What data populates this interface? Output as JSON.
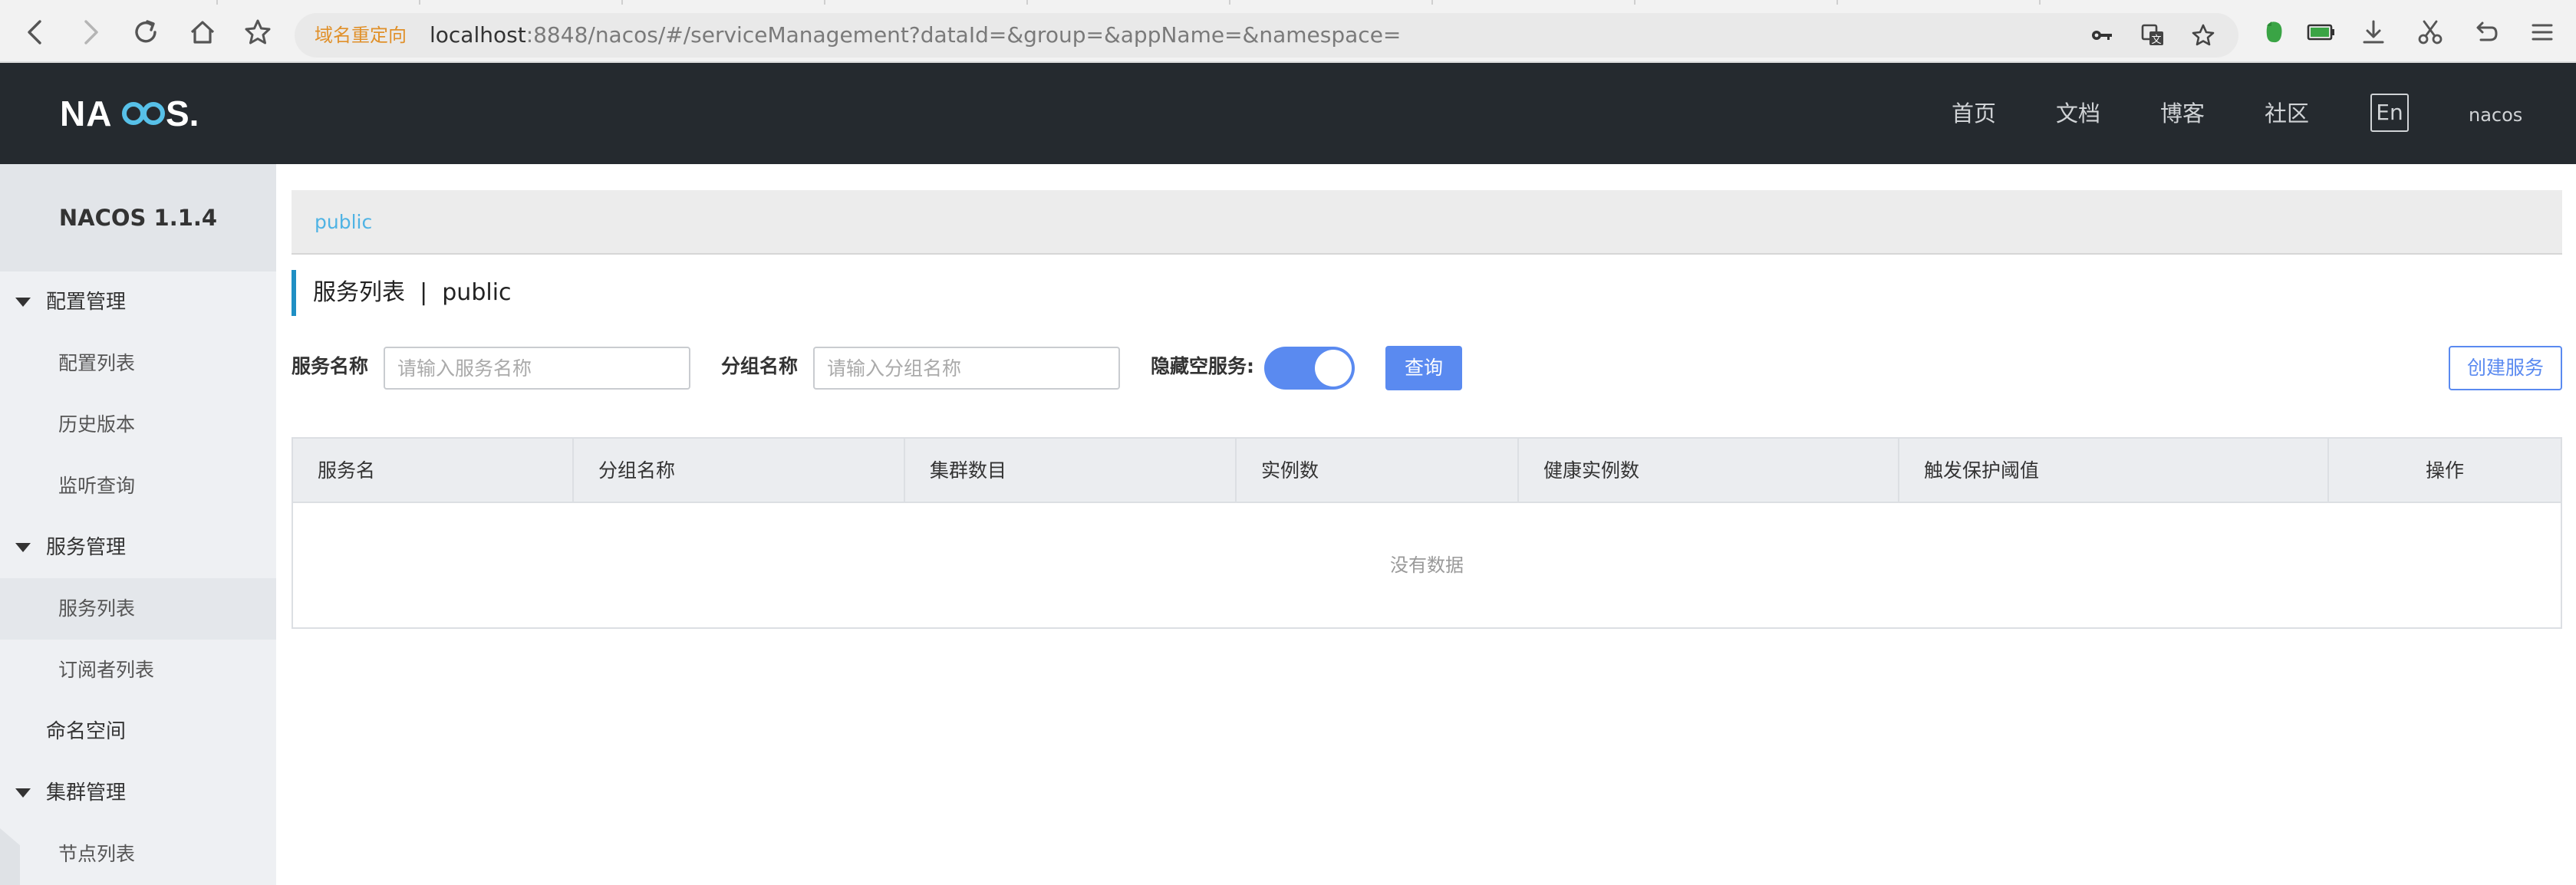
{
  "browser": {
    "url_warning": "域名重定向",
    "url_host": "localhost",
    "url_rest": ":8848/nacos/#/serviceManagement?dataId=&group=&appName=&namespace="
  },
  "header": {
    "logo_text": "NACOS.",
    "nav": [
      "首页",
      "文档",
      "博客",
      "社区"
    ],
    "lang": "En",
    "user": "nacos"
  },
  "sidebar": {
    "title": "NACOS 1.1.4",
    "groups": [
      {
        "label": "配置管理",
        "items": [
          "配置列表",
          "历史版本",
          "监听查询"
        ]
      },
      {
        "label": "服务管理",
        "items": [
          "服务列表",
          "订阅者列表"
        ]
      },
      {
        "label": "命名空间"
      },
      {
        "label": "集群管理",
        "items": [
          "节点列表"
        ]
      }
    ]
  },
  "main": {
    "breadcrumb": "public",
    "title": "服务列表",
    "title_sep": "|",
    "title_namespace": "public",
    "filters": {
      "service_name_label": "服务名称",
      "service_name_placeholder": "请输入服务名称",
      "group_name_label": "分组名称",
      "group_name_placeholder": "请输入分组名称",
      "hide_empty_label": "隐藏空服务:",
      "hide_empty_on": true,
      "query_label": "查询",
      "create_label": "创建服务"
    },
    "table": {
      "columns": [
        "服务名",
        "分组名称",
        "集群数目",
        "实例数",
        "健康实例数",
        "触发保护阈值",
        "操作"
      ],
      "empty_text": "没有数据"
    }
  }
}
